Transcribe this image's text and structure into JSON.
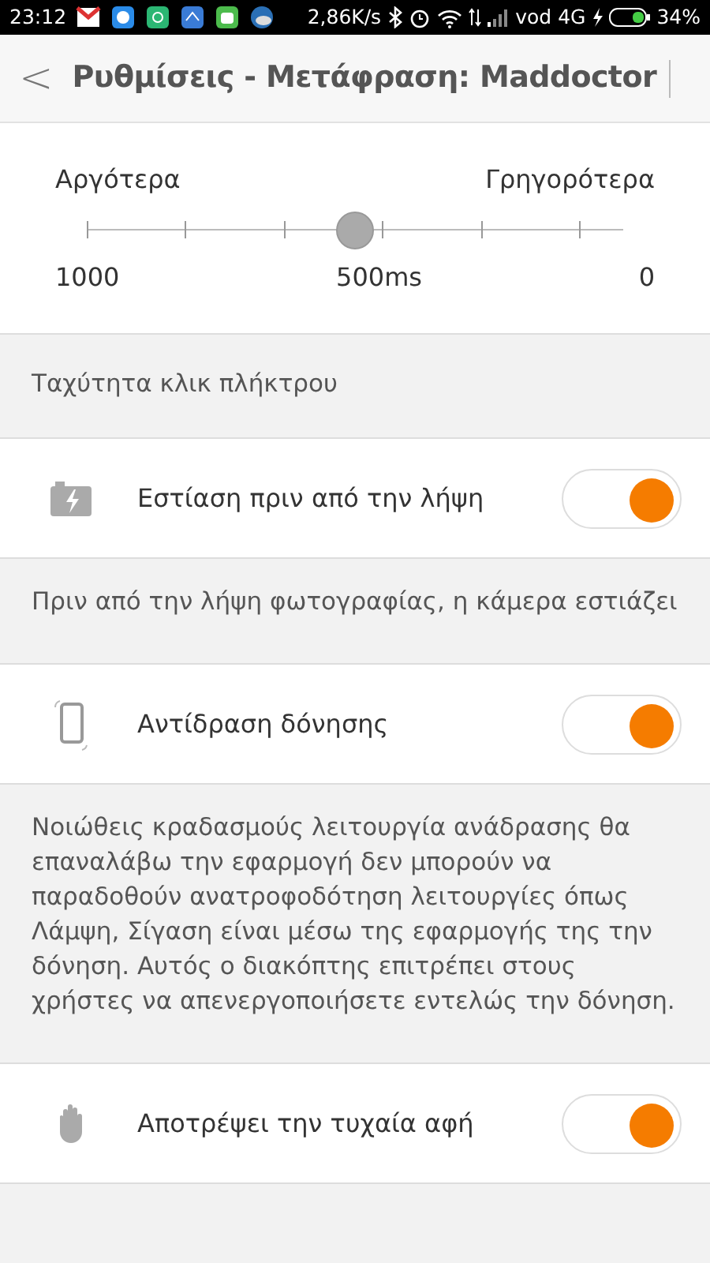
{
  "status_bar": {
    "time": "23:12",
    "speed": "2,86K/s",
    "carrier": "vod",
    "network": "4G",
    "battery": "34%"
  },
  "header": {
    "back": "<",
    "title": "Ρυθμίσεις - Μετάφραση: Maddoctor"
  },
  "slider": {
    "left_label": "Αργότερα",
    "right_label": "Γρηγορότερα",
    "min_label": "1000",
    "value_label": "500ms",
    "max_label": "0",
    "level": 0.5
  },
  "caption": "Ταχύτητα κλικ πλήκτρου",
  "settings": [
    {
      "label": "Εστίαση πριν από την λήψη",
      "on": true,
      "description": "Πριν από την λήψη φωτογραφίας, η κάμερα εστιάζει"
    },
    {
      "label": "Αντίδραση δόνησης",
      "on": true,
      "description": "Νοιώθεις κραδασμούς λειτουργία ανάδρασης θα επαναλάβω την εφαρμογή δεν μπορούν να παραδοθούν ανατροφοδότηση λειτουργίες όπως Λάμψη, Σίγαση είναι μέσω της εφαρμογής της την δόνηση. Αυτός ο διακόπτης επιτρέπει στους χρήστες να απενεργοποιήσετε εντελώς την δόνηση."
    },
    {
      "label": "Αποτρέψει την τυχαία αφή",
      "on": true
    }
  ]
}
